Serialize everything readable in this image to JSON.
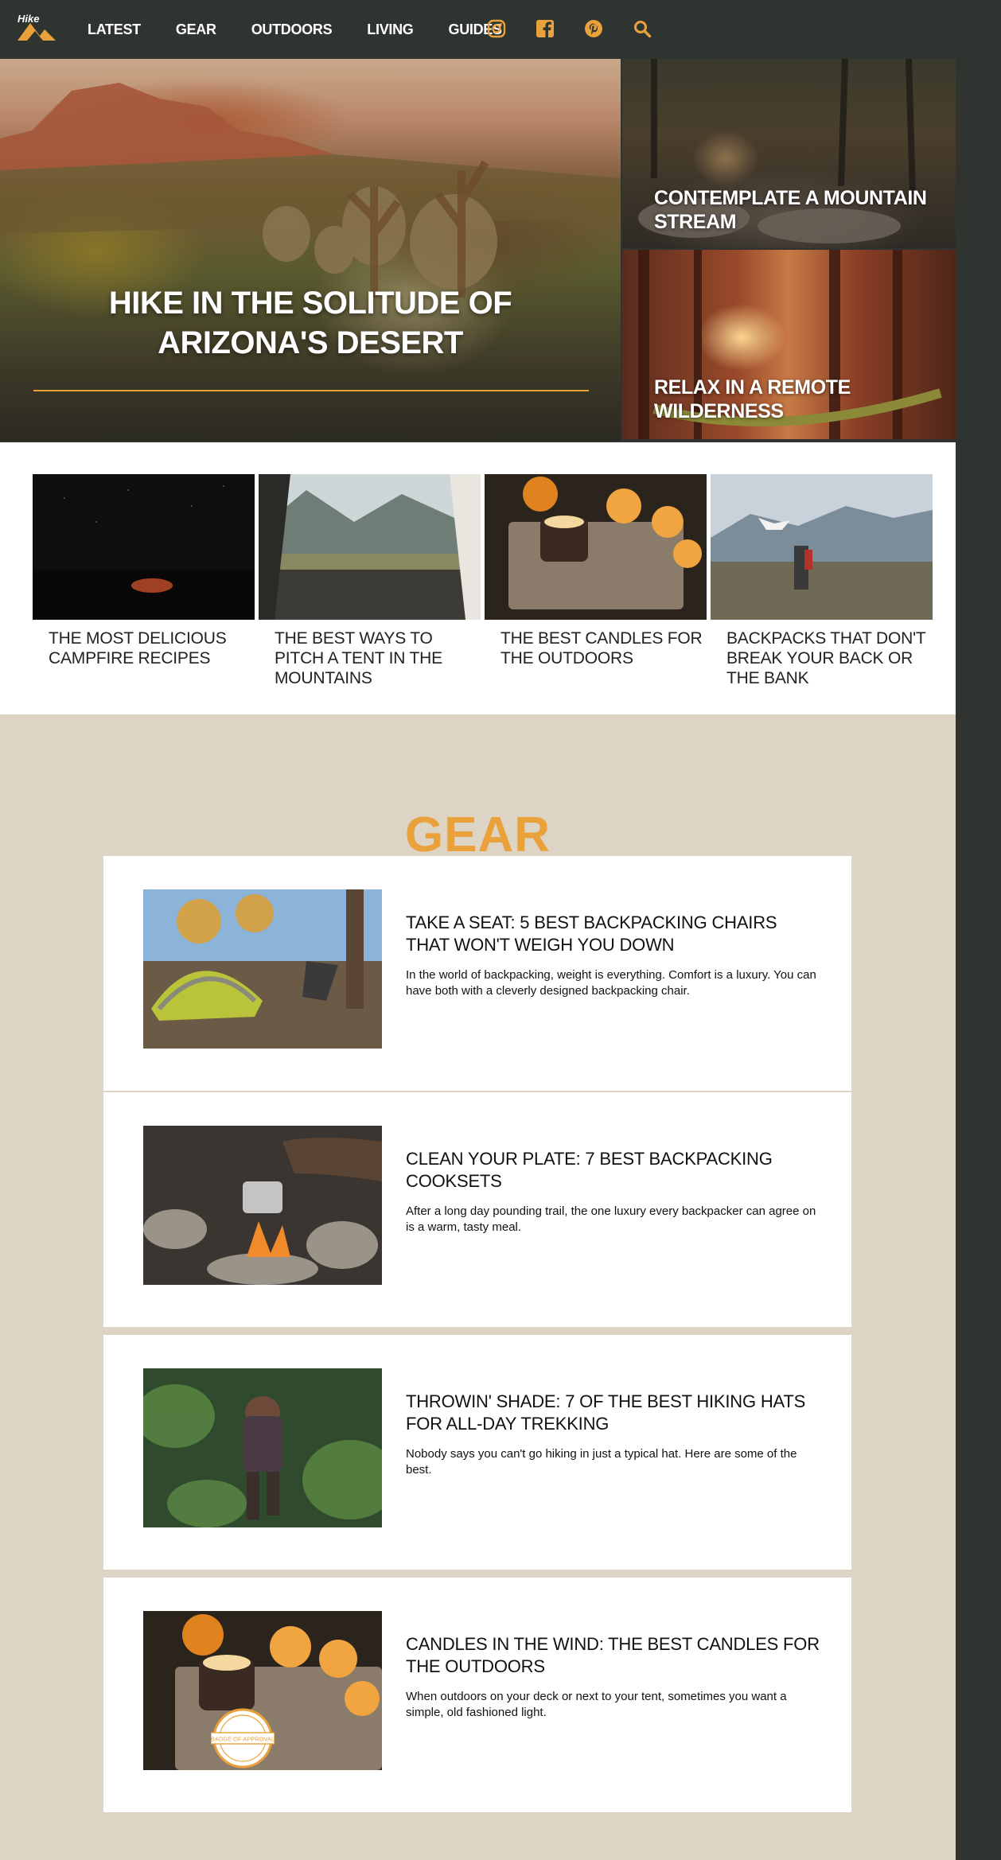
{
  "logo": {
    "text": "Hike"
  },
  "nav": [
    "LATEST",
    "GEAR",
    "OUTDOORS",
    "LIVING",
    "GUIDES"
  ],
  "social": [
    "instagram-icon",
    "facebook-icon",
    "pinterest-icon",
    "search-icon"
  ],
  "colors": {
    "accent": "#e9a23b",
    "dark": "#2f3430",
    "sand": "#ddd4c5"
  },
  "hero": {
    "main_title": "HIKE IN THE SOLITUDE OF ARIZONA'S DESERT",
    "side": [
      {
        "title": "CONTEMPLATE A MOUNTAIN STREAM"
      },
      {
        "title": "RELAX IN A REMOTE WILDERNESS"
      }
    ]
  },
  "strip": [
    {
      "title": "THE MOST DELICIOUS CAMPFIRE RECIPES"
    },
    {
      "title": "THE BEST WAYS TO PITCH A TENT IN THE MOUNTAINS"
    },
    {
      "title": "THE BEST CANDLES FOR THE OUTDOORS"
    },
    {
      "title": "BACKPACKS THAT DON'T BREAK YOUR BACK OR THE BANK"
    }
  ],
  "gear": {
    "heading": "GEAR",
    "articles": [
      {
        "title": "TAKE A SEAT: 5 BEST BACKPACKING CHAIRS THAT WON'T WEIGH YOU DOWN",
        "desc": "In the world of backpacking, weight is everything. Comfort is a luxury. You can have both with a cleverly designed backpacking chair."
      },
      {
        "title": "CLEAN YOUR PLATE: 7 BEST BACKPACKING COOKSETS",
        "desc": "After a long day pounding trail, the one luxury every backpacker can agree on is a warm, tasty meal."
      },
      {
        "title": "THROWIN' SHADE: 7 OF THE BEST HIKING HATS FOR ALL-DAY TREKKING",
        "desc": "Nobody says you can't go hiking in just a typical hat. Here are some of the best."
      },
      {
        "title": "CANDLES IN THE WIND: THE BEST CANDLES FOR THE OUTDOORS",
        "desc": "When outdoors on your deck or next to your tent, sometimes you want a simple, old fashioned light.",
        "badge": "BADGE OF APPROVAL"
      }
    ]
  }
}
